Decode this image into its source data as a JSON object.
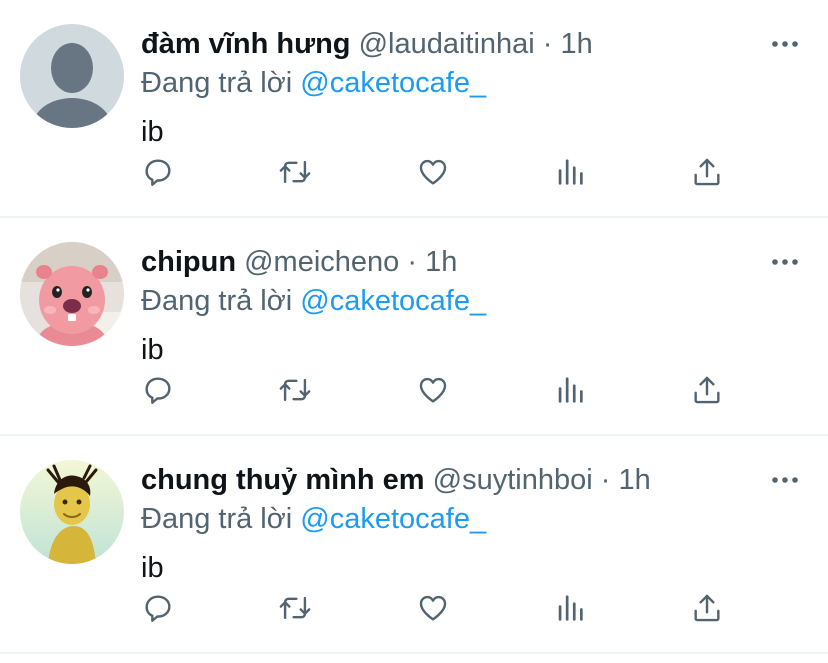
{
  "colors": {
    "text": "#0f1419",
    "secondary": "#536471",
    "accent": "#1d9bf0",
    "divider": "#eff3f4"
  },
  "tweets": [
    {
      "display_name": "đàm vĩnh hưng",
      "handle": "@laudaitinhai",
      "separator": "·",
      "time": "1h",
      "reply_prefix": "Đang trả lời",
      "reply_to": "@caketocafe_",
      "text": "ib",
      "avatar": "default-avatar-icon"
    },
    {
      "display_name": "chipun",
      "handle": "@meicheno",
      "separator": "·",
      "time": "1h",
      "reply_prefix": "Đang trả lời",
      "reply_to": "@caketocafe_",
      "text": "ib",
      "avatar": "pink-beaver-avatar"
    },
    {
      "display_name": "chung thuỷ mình em",
      "handle": "@suytinhboi",
      "separator": "·",
      "time": "1h",
      "reply_prefix": "Đang trả lời",
      "reply_to": "@caketocafe_",
      "text": "ib",
      "avatar": "yellow-character-avatar"
    }
  ],
  "actions": [
    "reply-icon",
    "retweet-icon",
    "like-icon",
    "views-icon",
    "share-icon"
  ]
}
